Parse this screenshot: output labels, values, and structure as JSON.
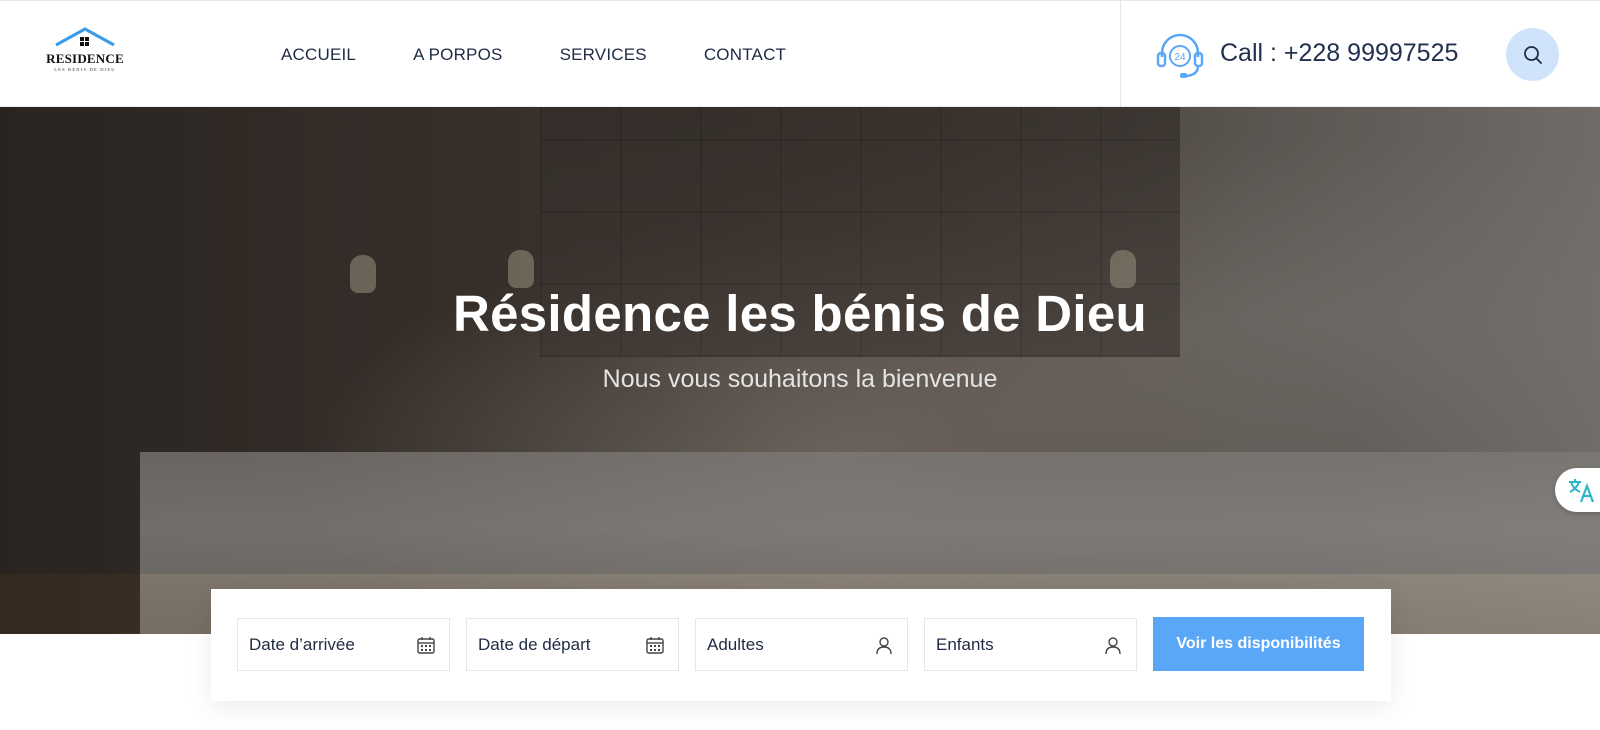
{
  "logo": {
    "title": "RESIDENCE",
    "tagline": "LES BENIS DE DIEU"
  },
  "nav": {
    "items": [
      "ACCUEIL",
      "A PORPOS",
      "SERVICES",
      "CONTACT"
    ]
  },
  "contact": {
    "call_text": "Call : +228 99997525",
    "badge": "24"
  },
  "hero": {
    "title": "Résidence les bénis de Dieu",
    "subtitle": "Nous vous souhaitons la bienvenue"
  },
  "booking": {
    "fields": [
      {
        "label": "Date d’arrivée",
        "icon": "calendar-icon"
      },
      {
        "label": "Date de départ",
        "icon": "calendar-icon"
      },
      {
        "label": "Adultes",
        "icon": "user-icon"
      },
      {
        "label": "Enfants",
        "icon": "user-icon"
      }
    ],
    "submit_label": "Voir les disponibilités"
  },
  "colors": {
    "accent": "#5aa6f7",
    "search_bg": "#cfe3fb",
    "text": "#1f2a44",
    "translate": "#2bb6c9"
  }
}
